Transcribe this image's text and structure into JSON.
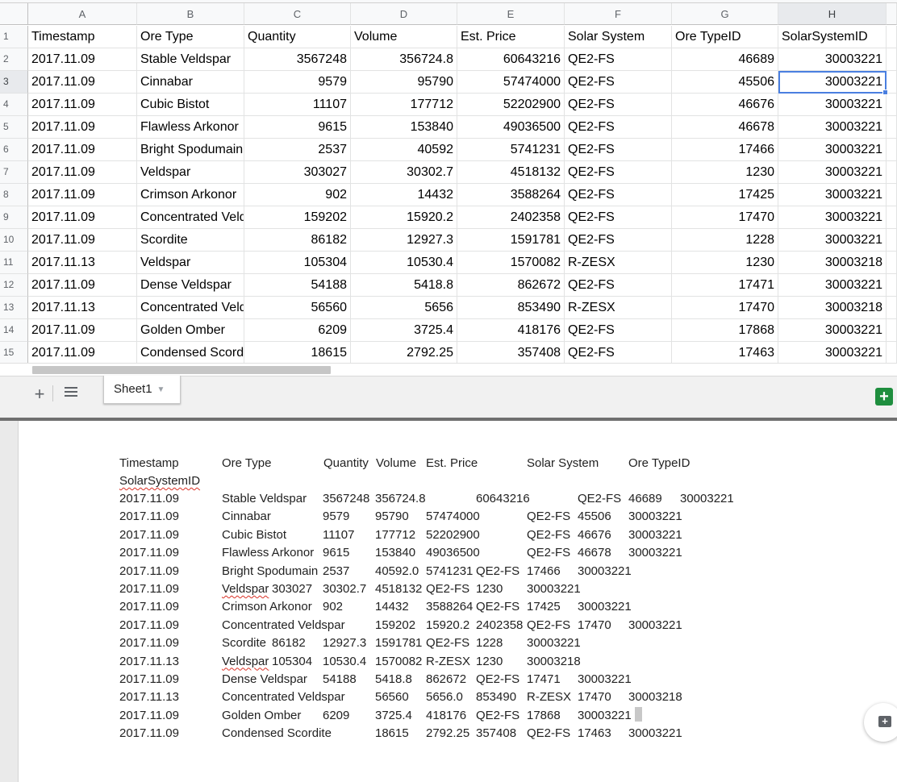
{
  "spreadsheet": {
    "columns": [
      "A",
      "B",
      "C",
      "D",
      "E",
      "F",
      "G",
      "H"
    ],
    "row_numbers": [
      "1",
      "2",
      "3",
      "4",
      "5",
      "6",
      "7",
      "8",
      "9",
      "10",
      "11",
      "12",
      "13",
      "14",
      "15"
    ],
    "header": [
      "Timestamp",
      "Ore Type",
      "Quantity",
      "Volume",
      "Est. Price",
      "Solar System",
      "Ore TypeID",
      "SolarSystemID"
    ],
    "rows": [
      [
        "2017.11.09",
        "Stable Veldspar",
        "3567248",
        "356724.8",
        "60643216",
        "QE2-FS",
        "46689",
        "30003221"
      ],
      [
        "2017.11.09",
        "Cinnabar",
        "9579",
        "95790",
        "57474000",
        "QE2-FS",
        "45506",
        "30003221"
      ],
      [
        "2017.11.09",
        "Cubic Bistot",
        "11107",
        "177712",
        "52202900",
        "QE2-FS",
        "46676",
        "30003221"
      ],
      [
        "2017.11.09",
        "Flawless Arkonor",
        "9615",
        "153840",
        "49036500",
        "QE2-FS",
        "46678",
        "30003221"
      ],
      [
        "2017.11.09",
        "Bright Spodumain",
        "2537",
        "40592",
        "5741231",
        "QE2-FS",
        "17466",
        "30003221"
      ],
      [
        "2017.11.09",
        "Veldspar",
        "303027",
        "30302.7",
        "4518132",
        "QE2-FS",
        "1230",
        "30003221"
      ],
      [
        "2017.11.09",
        "Crimson Arkonor",
        "902",
        "14432",
        "3588264",
        "QE2-FS",
        "17425",
        "30003221"
      ],
      [
        "2017.11.09",
        "Concentrated Veldspar",
        "159202",
        "15920.2",
        "2402358",
        "QE2-FS",
        "17470",
        "30003221"
      ],
      [
        "2017.11.09",
        "Scordite",
        "86182",
        "12927.3",
        "1591781",
        "QE2-FS",
        "1228",
        "30003221"
      ],
      [
        "2017.11.13",
        "Veldspar",
        "105304",
        "10530.4",
        "1570082",
        "R-ZESX",
        "1230",
        "30003218"
      ],
      [
        "2017.11.09",
        "Dense Veldspar",
        "54188",
        "5418.8",
        "862672",
        "QE2-FS",
        "17471",
        "30003221"
      ],
      [
        "2017.11.13",
        "Concentrated Veldspar",
        "56560",
        "5656",
        "853490",
        "R-ZESX",
        "17470",
        "30003218"
      ],
      [
        "2017.11.09",
        "Golden Omber",
        "6209",
        "3725.4",
        "418176",
        "QE2-FS",
        "17868",
        "30003221"
      ],
      [
        "2017.11.09",
        "Condensed Scordite",
        "18615",
        "2792.25",
        "357408",
        "QE2-FS",
        "17463",
        "30003221"
      ]
    ],
    "selected_cell": "H3",
    "selection_color": "#4a7fe0"
  },
  "tabs": {
    "add_label": "+",
    "sheet_tab_label": "Sheet1",
    "sheet_tab_caret": "▼",
    "explore_glyph": "+"
  },
  "doc": {
    "header_line": [
      "Timestamp",
      "Ore Type",
      "Quantity",
      "Volume",
      "Est. Price",
      "Solar System",
      "Ore TypeID"
    ],
    "header_wrap": "SolarSystemID",
    "lines": [
      [
        "2017.11.09",
        "Stable Veldspar",
        "3567248",
        "356724.8",
        "60643216",
        "QE2-FS",
        "46689",
        "30003221"
      ],
      [
        "2017.11.09",
        "Cinnabar",
        "9579",
        "95790",
        "57474000",
        "QE2-FS",
        "45506",
        "30003221"
      ],
      [
        "2017.11.09",
        "Cubic Bistot",
        "11107",
        "177712",
        "52202900",
        "QE2-FS",
        "46676",
        "30003221"
      ],
      [
        "2017.11.09",
        "Flawless Arkonor",
        "9615",
        "153840",
        "49036500",
        "QE2-FS",
        "46678",
        "30003221"
      ],
      [
        "2017.11.09",
        "Bright Spodumain",
        "2537",
        "40592.0",
        "5741231",
        "QE2-FS",
        "17466",
        "30003221"
      ],
      [
        "2017.11.09",
        "Veldspar",
        "303027",
        "30302.7",
        "4518132",
        "QE2-FS",
        "1230",
        "30003221"
      ],
      [
        "2017.11.09",
        "Crimson Arkonor",
        "902",
        "14432",
        "3588264",
        "QE2-FS",
        "17425",
        "30003221"
      ],
      [
        "2017.11.09",
        "Concentrated Veldspar",
        "159202",
        "15920.2",
        "2402358",
        "QE2-FS",
        "17470",
        "30003221"
      ],
      [
        "2017.11.09",
        "Scordite",
        "86182",
        "12927.3",
        "1591781",
        "QE2-FS",
        "1228",
        "30003221"
      ],
      [
        "2017.11.13",
        "Veldspar",
        "105304",
        "10530.4",
        "1570082",
        "R-ZESX",
        "1230",
        "30003218"
      ],
      [
        "2017.11.09",
        "Dense Veldspar",
        "54188",
        "5418.8",
        "862672",
        "QE2-FS",
        "17471",
        "30003221"
      ],
      [
        "2017.11.13",
        "Concentrated Veldspar",
        "56560",
        "5656.0",
        "853490",
        "R-ZESX",
        "17470",
        "30003218"
      ],
      [
        "2017.11.09",
        "Golden Omber",
        "6209",
        "3725.4",
        "418176",
        "QE2-FS",
        "17868",
        "30003221"
      ],
      [
        "2017.11.09",
        "Condensed Scordite",
        "18615",
        "2792.25",
        "357408",
        "QE2-FS",
        "17463",
        "30003221"
      ]
    ],
    "misspelled_word": "Veldspar"
  },
  "icons": {
    "add_sheet": "plus-icon",
    "all_sheets": "list-icon",
    "explore": "explore-icon",
    "comment": "add-comment-icon"
  }
}
